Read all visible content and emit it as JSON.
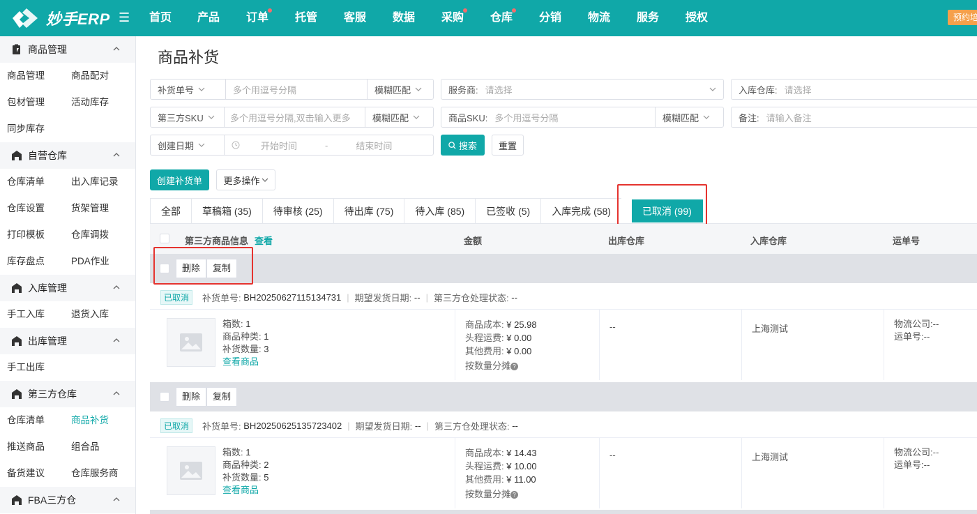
{
  "topbar": {
    "logo_text": "妙手ERP",
    "nav": [
      {
        "label": "首页",
        "dot": false
      },
      {
        "label": "产品",
        "dot": false
      },
      {
        "label": "订单",
        "dot": true
      },
      {
        "label": "托管",
        "dot": false
      },
      {
        "label": "客服",
        "dot": false
      },
      {
        "label": "数据",
        "dot": false
      },
      {
        "label": "采购",
        "dot": true
      },
      {
        "label": "仓库",
        "dot": true
      },
      {
        "label": "分销",
        "dot": false
      },
      {
        "label": "物流",
        "dot": false
      },
      {
        "label": "服务",
        "dot": false
      },
      {
        "label": "授权",
        "dot": false
      }
    ],
    "badge": "预约培训",
    "accent": "#10a8a8"
  },
  "sidebar": {
    "sections": [
      {
        "label": "商品管理",
        "icon": "clipboard-icon",
        "items": [
          "商品管理",
          "商品配对",
          "包材管理",
          "活动库存",
          "同步库存"
        ]
      },
      {
        "label": "自营仓库",
        "icon": "warehouse-icon",
        "items": [
          "仓库清单",
          "出入库记录",
          "仓库设置",
          "货架管理",
          "打印模板",
          "仓库调拨",
          "库存盘点",
          "PDA作业"
        ]
      },
      {
        "label": "入库管理",
        "icon": "warehouse-icon",
        "items": [
          "手工入库",
          "退货入库"
        ]
      },
      {
        "label": "出库管理",
        "icon": "warehouse-icon",
        "items": [
          "手工出库"
        ]
      },
      {
        "label": "第三方仓库",
        "icon": "warehouse-icon",
        "items": [
          "仓库清单",
          "商品补货",
          "推送商品",
          "组合品",
          "备货建议",
          "仓库服务商"
        ]
      },
      {
        "label": "FBA三方仓",
        "icon": "warehouse-icon",
        "items": []
      }
    ],
    "active_item": "商品补货"
  },
  "page": {
    "title": "商品补货"
  },
  "filters": {
    "replenish_no": {
      "select": "补货单号",
      "placeholder": "多个用逗号分隔",
      "match": "模糊匹配"
    },
    "provider": {
      "label": "服务商:",
      "placeholder": "请选择"
    },
    "in_warehouse": {
      "label": "入库仓库:",
      "placeholder": "请选择"
    },
    "third_sku": {
      "select": "第三方SKU",
      "placeholder": "多个用逗号分隔,双击输入更多",
      "match": "模糊匹配"
    },
    "product_sku": {
      "label": "商品SKU:",
      "placeholder": "多个用逗号分隔",
      "match": "模糊匹配"
    },
    "remark": {
      "label": "备注:",
      "placeholder": "请输入备注"
    },
    "date": {
      "select": "创建日期",
      "start": "开始时间",
      "dash": "-",
      "end": "结束时间"
    },
    "search_btn": "搜索",
    "reset_btn": "重置"
  },
  "actions": {
    "create": "创建补货单",
    "more": "更多操作"
  },
  "tabs": [
    {
      "label": "全部"
    },
    {
      "label": "草稿箱 (35)"
    },
    {
      "label": "待审核 (25)"
    },
    {
      "label": "待出库 (75)"
    },
    {
      "label": "待入库 (85)"
    },
    {
      "label": "已签收 (5)"
    },
    {
      "label": "入库完成 (58)"
    },
    {
      "label": "已取消 (99)"
    }
  ],
  "table": {
    "headers": {
      "info": "第三方商品信息",
      "view": "查看",
      "amount": "金额",
      "out_wh": "出库仓库",
      "in_wh": "入库仓库",
      "tracking": "运单号"
    },
    "bulk": {
      "delete": "删除",
      "copy": "复制"
    },
    "meta_labels": {
      "no": "补货单号:",
      "date": "期望发货日期:",
      "state": "第三方仓处理状态:"
    },
    "info_labels": {
      "boxes": "箱数:",
      "kinds": "商品种类:",
      "qty": "补货数量:",
      "view_goods": "查看商品"
    },
    "cost_labels": {
      "cost": "商品成本:",
      "freight": "头程运费:",
      "other": "其他费用:",
      "split": "按数量分摊"
    },
    "track_labels": {
      "company": "物流公司:",
      "no": "运单号:"
    },
    "rows": [
      {
        "status": "已取消",
        "no": "BH20250627115134731",
        "date": "--",
        "state": "--",
        "boxes": "1",
        "kinds": "1",
        "qty": "3",
        "cost": "¥ 25.98",
        "freight": "¥ 0.00",
        "other": "¥ 0.00",
        "out_wh": "--",
        "in_wh": "上海测试",
        "company": "--",
        "track_no": "--"
      },
      {
        "status": "已取消",
        "no": "BH20250625135723402",
        "date": "--",
        "state": "--",
        "boxes": "1",
        "kinds": "2",
        "qty": "5",
        "cost": "¥ 14.43",
        "freight": "¥ 10.00",
        "other": "¥ 11.00",
        "out_wh": "--",
        "in_wh": "上海测试",
        "company": "--",
        "track_no": "--"
      }
    ]
  }
}
